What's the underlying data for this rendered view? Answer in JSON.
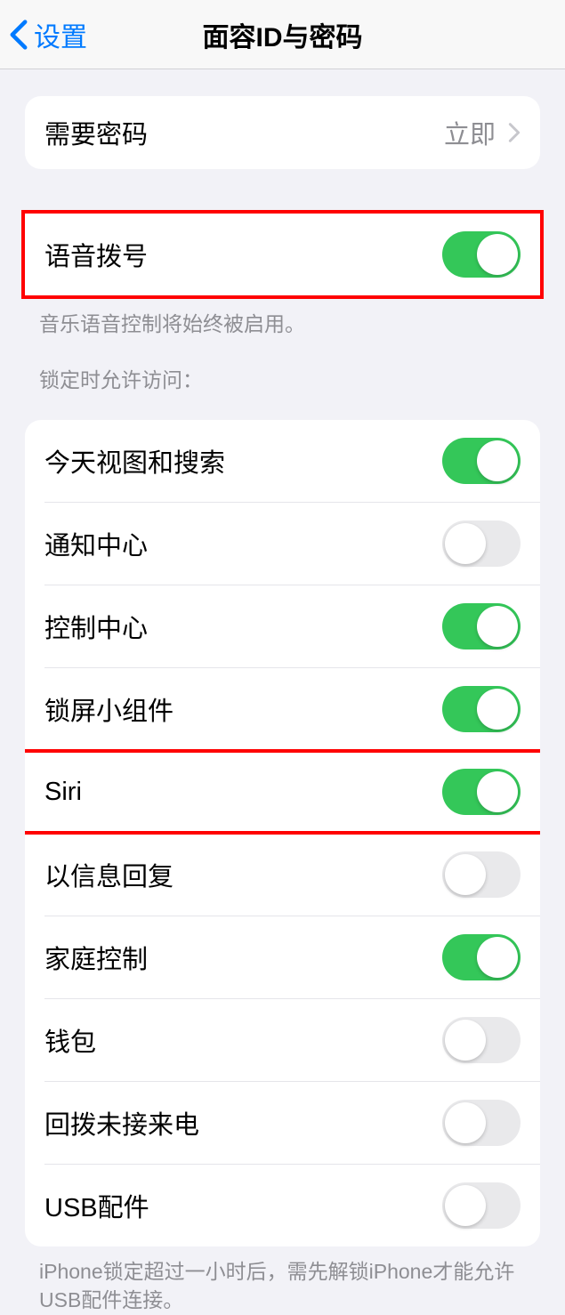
{
  "nav": {
    "back": "设置",
    "title": "面容ID与密码"
  },
  "passcode": {
    "label": "需要密码",
    "value": "立即"
  },
  "voiceDial": {
    "label": "语音拨号",
    "on": true,
    "footer": "音乐语音控制将始终被启用。"
  },
  "lockAccess": {
    "header": "锁定时允许访问：",
    "items": [
      {
        "label": "今天视图和搜索",
        "on": true
      },
      {
        "label": "通知中心",
        "on": false
      },
      {
        "label": "控制中心",
        "on": true
      },
      {
        "label": "锁屏小组件",
        "on": true
      },
      {
        "label": "Siri",
        "on": true,
        "highlight": true
      },
      {
        "label": "以信息回复",
        "on": false
      },
      {
        "label": "家庭控制",
        "on": true
      },
      {
        "label": "钱包",
        "on": false
      },
      {
        "label": "回拨未接来电",
        "on": false
      },
      {
        "label": "USB配件",
        "on": false
      }
    ],
    "footer": "iPhone锁定超过一小时后，需先解锁iPhone才能允许USB配件连接。"
  }
}
